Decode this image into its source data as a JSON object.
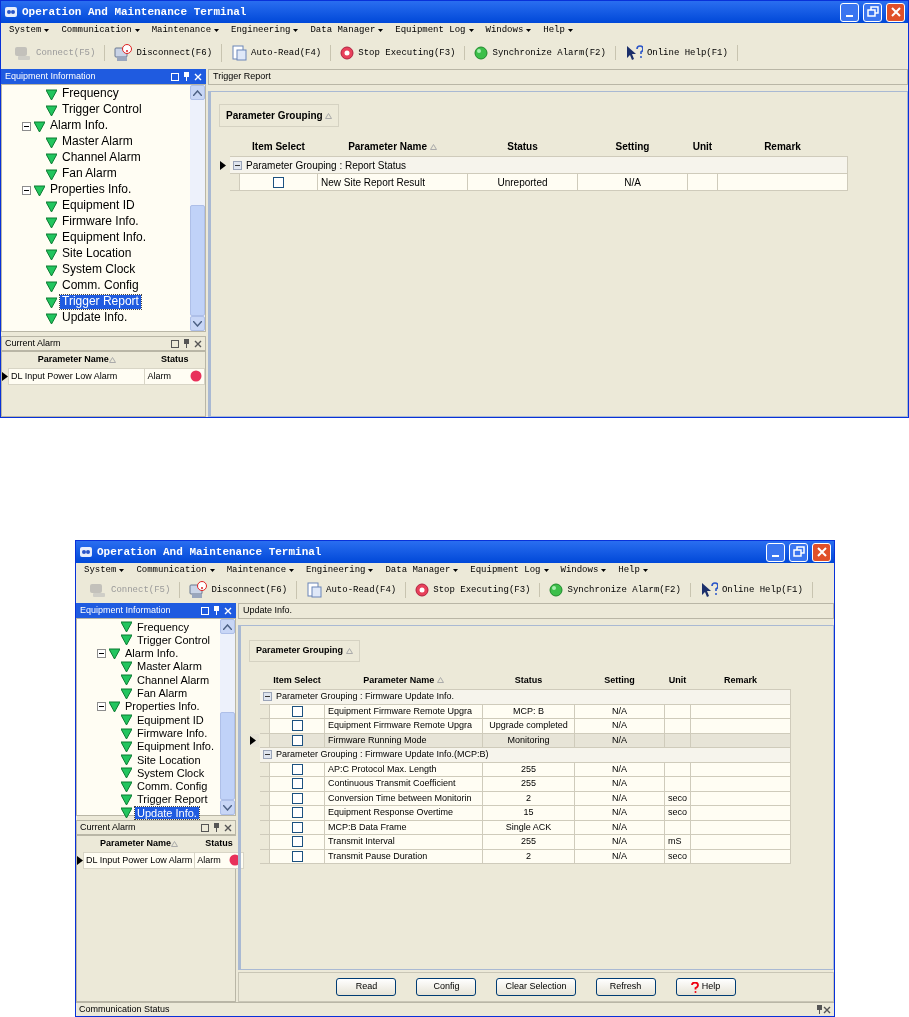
{
  "windows": [
    {
      "title": "Operation And Maintenance Terminal",
      "menu": [
        "System",
        "Communication",
        "Maintenance",
        "Engineering",
        "Data Manager",
        "Equipment Log",
        "Windows",
        "Help"
      ],
      "toolbar": [
        {
          "kind": "connect",
          "label": "Connect(F5)",
          "disabled": true
        },
        {
          "kind": "disconnect",
          "label": "Disconnect(F6)",
          "disabled": false
        },
        {
          "kind": "auto-read",
          "label": "Auto-Read(F4)",
          "disabled": false
        },
        {
          "kind": "stop",
          "label": "Stop Executing(F3)",
          "disabled": false
        },
        {
          "kind": "sync",
          "label": "Synchronize Alarm(F2)",
          "disabled": false
        },
        {
          "kind": "help",
          "label": "Online Help(F1)",
          "disabled": false
        }
      ],
      "equipment_panel": {
        "title": "Equipment Information",
        "active": true,
        "tree": [
          {
            "label": "Frequency",
            "selected": false
          },
          {
            "label": "Trigger Control",
            "selected": false
          },
          {
            "label": "Alarm Info.",
            "selected": false,
            "expanded": true,
            "children": [
              {
                "label": "Master Alarm",
                "selected": false
              },
              {
                "label": "Channel Alarm",
                "selected": false
              },
              {
                "label": "Fan Alarm",
                "selected": false
              }
            ]
          },
          {
            "label": "Properties Info.",
            "selected": false,
            "expanded": true,
            "children": [
              {
                "label": "Equipment ID",
                "selected": false
              },
              {
                "label": "Firmware Info.",
                "selected": false
              },
              {
                "label": "Equipment Info.",
                "selected": false
              },
              {
                "label": "Site Location",
                "selected": false
              },
              {
                "label": "System Clock",
                "selected": false
              },
              {
                "label": "Comm. Config",
                "selected": false
              },
              {
                "label": "Trigger Report",
                "selected": true
              },
              {
                "label": "Update Info.",
                "selected": false
              }
            ]
          }
        ]
      },
      "alarm_panel": {
        "title": "Current Alarm",
        "active": false,
        "columns": [
          "Parameter Name",
          "Status"
        ],
        "rows": [
          {
            "name": "DL Input Power Low Alarm",
            "status": "Alarm",
            "color": "#e8305a",
            "selected": true
          }
        ]
      },
      "content": {
        "tab_title": "Trigger Report",
        "grouping_label": "Parameter Grouping",
        "columns": [
          "Item Select",
          "Parameter Name",
          "Status",
          "Setting",
          "Unit",
          "Remark"
        ],
        "groups": [
          {
            "label": "Parameter Grouping : Report Status",
            "expanded": true,
            "selected": true,
            "rows": [
              {
                "checked": false,
                "selected": false,
                "name": "New Site Report Result",
                "status": "Unreported",
                "setting": "N/A"
              }
            ]
          }
        ]
      }
    },
    {
      "title": "Operation And Maintenance Terminal",
      "menu": [
        "System",
        "Communication",
        "Maintenance",
        "Engineering",
        "Data Manager",
        "Equipment Log",
        "Windows",
        "Help"
      ],
      "toolbar": [
        {
          "kind": "connect",
          "label": "Connect(F5)",
          "disabled": true
        },
        {
          "kind": "disconnect",
          "label": "Disconnect(F6)",
          "disabled": false
        },
        {
          "kind": "auto-read",
          "label": "Auto-Read(F4)",
          "disabled": false
        },
        {
          "kind": "stop",
          "label": "Stop Executing(F3)",
          "disabled": false
        },
        {
          "kind": "sync",
          "label": "Synchronize Alarm(F2)",
          "disabled": false
        },
        {
          "kind": "help",
          "label": "Online Help(F1)",
          "disabled": false
        }
      ],
      "equipment_panel": {
        "title": "Equipment Information",
        "active": true,
        "tree": [
          {
            "label": "Frequency",
            "selected": false
          },
          {
            "label": "Trigger Control",
            "selected": false
          },
          {
            "label": "Alarm Info.",
            "selected": false,
            "expanded": true,
            "children": [
              {
                "label": "Master Alarm",
                "selected": false
              },
              {
                "label": "Channel Alarm",
                "selected": false
              },
              {
                "label": "Fan Alarm",
                "selected": false
              }
            ]
          },
          {
            "label": "Properties Info.",
            "selected": false,
            "expanded": true,
            "children": [
              {
                "label": "Equipment ID",
                "selected": false
              },
              {
                "label": "Firmware Info.",
                "selected": false
              },
              {
                "label": "Equipment Info.",
                "selected": false
              },
              {
                "label": "Site Location",
                "selected": false
              },
              {
                "label": "System Clock",
                "selected": false
              },
              {
                "label": "Comm. Config",
                "selected": false
              },
              {
                "label": "Trigger Report",
                "selected": false
              },
              {
                "label": "Update Info.",
                "selected": true
              }
            ]
          }
        ]
      },
      "alarm_panel": {
        "title": "Current Alarm",
        "active": false,
        "columns": [
          "Parameter Name",
          "Status"
        ],
        "rows": [
          {
            "name": "DL Input Power Low Alarm",
            "status": "Alarm",
            "color": "#e8305a",
            "selected": true
          }
        ]
      },
      "content": {
        "tab_title": "Update Info.",
        "grouping_label": "Parameter Grouping",
        "columns": [
          "Item Select",
          "Parameter Name",
          "Status",
          "Setting",
          "Unit",
          "Remark"
        ],
        "groups": [
          {
            "label": "Parameter Grouping : Firmware Update Info.",
            "expanded": true,
            "selected": false,
            "rows": [
              {
                "checked": false,
                "selected": false,
                "name": "Equipment Firmware Remote Upgra",
                "status": "MCP: B",
                "setting": "N/A"
              },
              {
                "checked": false,
                "selected": false,
                "name": "Equipment Firmware Remote Upgra",
                "status": "Upgrade completed",
                "setting": "N/A"
              },
              {
                "checked": false,
                "selected": true,
                "name": "Firmware Running Mode",
                "status": "Monitoring",
                "setting": "N/A"
              }
            ]
          },
          {
            "label": "Parameter Grouping : Firmware Update Info.(MCP:B)",
            "expanded": true,
            "selected": false,
            "rows": [
              {
                "checked": false,
                "selected": false,
                "name": "AP:C Protocol Max. Length",
                "status": "255",
                "setting": "N/A"
              },
              {
                "checked": false,
                "selected": false,
                "name": "Continuous Transmit Coefficient",
                "status": "255",
                "setting": "N/A"
              },
              {
                "checked": false,
                "selected": false,
                "name": "Conversion Time between Monitorin",
                "status": "2",
                "setting": "N/A",
                "unit": "seco"
              },
              {
                "checked": false,
                "selected": false,
                "name": "Equipment Response Overtime",
                "status": "15",
                "setting": "N/A",
                "unit": "seco"
              },
              {
                "checked": false,
                "selected": false,
                "name": "MCP:B Data Frame",
                "status": "Single ACK",
                "setting": "N/A"
              },
              {
                "checked": false,
                "selected": false,
                "name": "Transmit Interval",
                "status": "255",
                "setting": "N/A",
                "unit": "mS"
              },
              {
                "checked": false,
                "selected": false,
                "name": "Transmit Pause Duration",
                "status": "2",
                "setting": "N/A",
                "unit": "seco"
              }
            ]
          }
        ],
        "buttons": [
          {
            "kind": "plain",
            "label": "Read"
          },
          {
            "kind": "plain",
            "label": "Config"
          },
          {
            "kind": "plain",
            "label": "Clear Selection"
          },
          {
            "kind": "plain",
            "label": "Refresh"
          },
          {
            "kind": "help",
            "label": "Help"
          }
        ]
      },
      "status_panel": {
        "title": "Communication Status"
      }
    }
  ]
}
